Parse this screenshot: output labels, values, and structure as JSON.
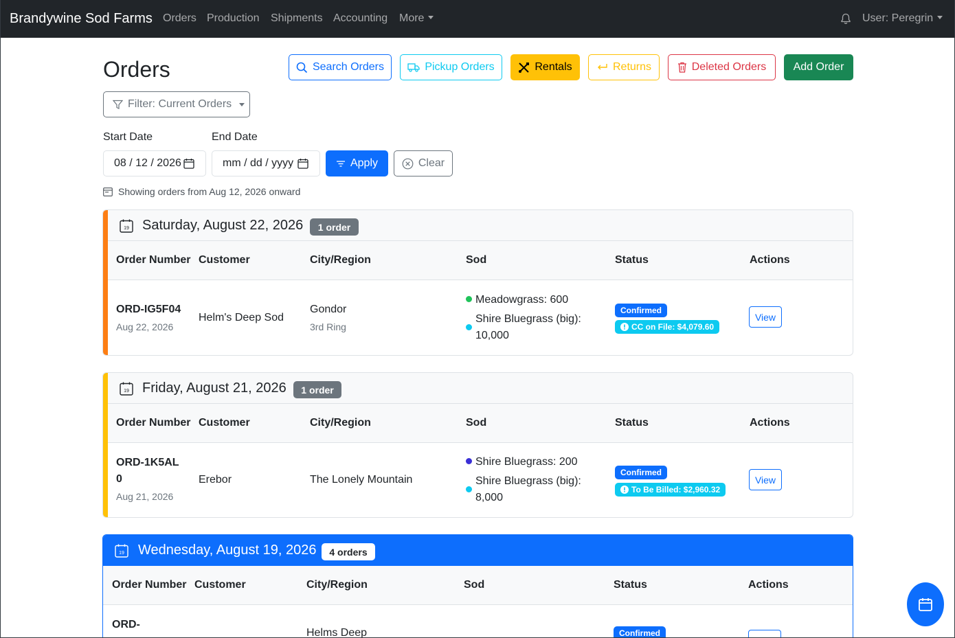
{
  "navbar": {
    "brand": "Brandywine Sod Farms",
    "items": [
      "Orders",
      "Production",
      "Shipments",
      "Accounting",
      "More"
    ],
    "user": "User: Peregrin"
  },
  "page": {
    "title": "Orders",
    "buttons": {
      "search": "Search Orders",
      "pickup": "Pickup Orders",
      "rentals": "Rentals",
      "returns": "Returns",
      "deleted": "Deleted Orders",
      "add": "Add Order"
    },
    "filter": "Filter: Current Orders",
    "start_label": "Start Date",
    "end_label": "End Date",
    "start_value": "08 / 12 / 2026",
    "end_placeholder": "mm / dd / yyyy",
    "apply": "Apply",
    "clear": "Clear",
    "info": "Showing orders from Aug 12, 2026 onward"
  },
  "columns": [
    "Order Number",
    "Customer",
    "City/Region",
    "Sod",
    "Status",
    "Actions"
  ],
  "groups": [
    {
      "date": "Saturday, August 22, 2026",
      "count": "1 order",
      "stripe": "#fd7e14",
      "order": {
        "number": "ORD-IG5F04",
        "date": "Aug 22, 2026",
        "customer": "Helm's Deep Sod",
        "city": "Gondor",
        "region": "3rd Ring",
        "sod1": "Meadowgrass: 600",
        "sod2a": "Shire Bluegrass (big):",
        "sod2b": "10,000",
        "status": "Confirmed",
        "billing": "CC on File: $4,079.60",
        "action": "View"
      }
    },
    {
      "date": "Friday, August 21, 2026",
      "count": "1 order",
      "stripe": "#ffc107",
      "order": {
        "number_a": "ORD-1K5AL",
        "number_b": "0",
        "date": "Aug 21, 2026",
        "customer": "Erebor",
        "city": "The Lonely Mountain",
        "sod1": "Shire Bluegrass: 200",
        "sod2a": "Shire Bluegrass (big):",
        "sod2b": "8,000",
        "status": "Confirmed",
        "billing": "To Be Billed: $2,960.32",
        "action": "View"
      }
    },
    {
      "date": "Wednesday, August 19, 2026",
      "count": "4 orders",
      "order": {
        "number": "ORD-",
        "city": "Helms Deep",
        "status": "Confirmed"
      }
    }
  ],
  "colors": {
    "primary": "#0d6efd",
    "info": "#0dcaf0",
    "warning": "#ffc107",
    "danger": "#dc3545",
    "success": "#198754",
    "dark": "#212529"
  }
}
